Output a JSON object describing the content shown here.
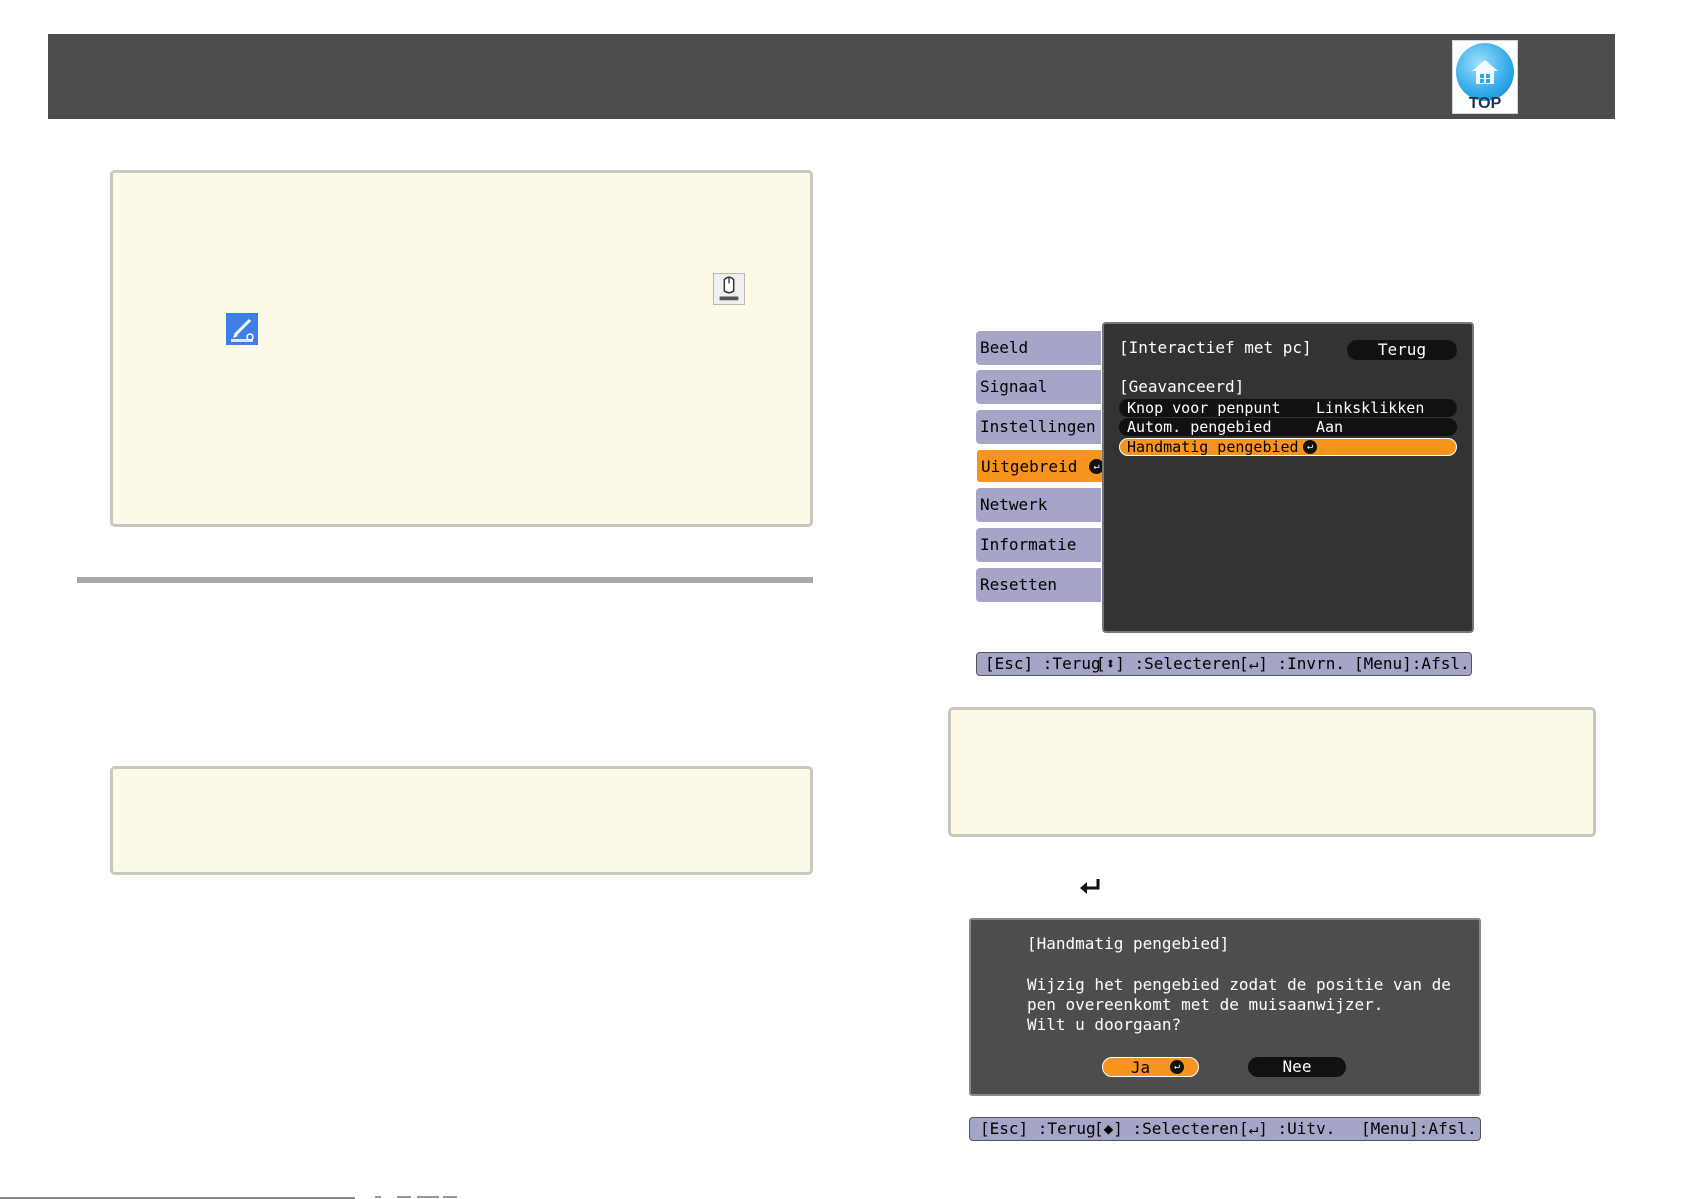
{
  "header": {
    "top_label": "TOP"
  },
  "menu": {
    "tabs": [
      {
        "label": "Beeld"
      },
      {
        "label": "Signaal"
      },
      {
        "label": "Instellingen"
      },
      {
        "label": "Uitgebreid",
        "active": true
      },
      {
        "label": "Netwerk"
      },
      {
        "label": "Informatie"
      },
      {
        "label": "Resetten"
      }
    ],
    "panel": {
      "section1": "[Interactief met pc]",
      "back_button": "Terug",
      "section2": "[Geavanceerd]",
      "rows": [
        {
          "label": "Knop voor penpunt",
          "value": "Linksklikken"
        },
        {
          "label": "Autom. pengebied",
          "value": "Aan"
        },
        {
          "label": "Handmatig pengebied",
          "value": ""
        }
      ]
    },
    "helpbar": {
      "esc": "[Esc] :Terug",
      "select": "[⬍] :Selecteren",
      "enter": "[↵] :Invrn.",
      "menu": "[Menu]:Afsl."
    }
  },
  "dialog": {
    "title": "[Handmatig pengebied]",
    "lines": [
      "Wijzig het pengebied zodat de positie van de",
      "pen overeenkomt met de muisaanwijzer.",
      "Wilt u doorgaan?"
    ],
    "yes": "Ja",
    "no": "Nee",
    "helpbar": {
      "esc": "[Esc] :Terug",
      "select": "[◆] :Selecteren",
      "enter": "[↵] :Uitv.",
      "menu": "[Menu]:Afsl."
    }
  },
  "colors": {
    "header_bg": "#4d4d4d",
    "note_bg": "#fdf9e7",
    "menu_tab": "#a5a5c8",
    "accent_orange": "#f7941d",
    "panel_bg": "#333333"
  },
  "icons": [
    "pen-mouse-icon",
    "pen-draw-icon",
    "enter-key-icon",
    "top-home-icon"
  ]
}
